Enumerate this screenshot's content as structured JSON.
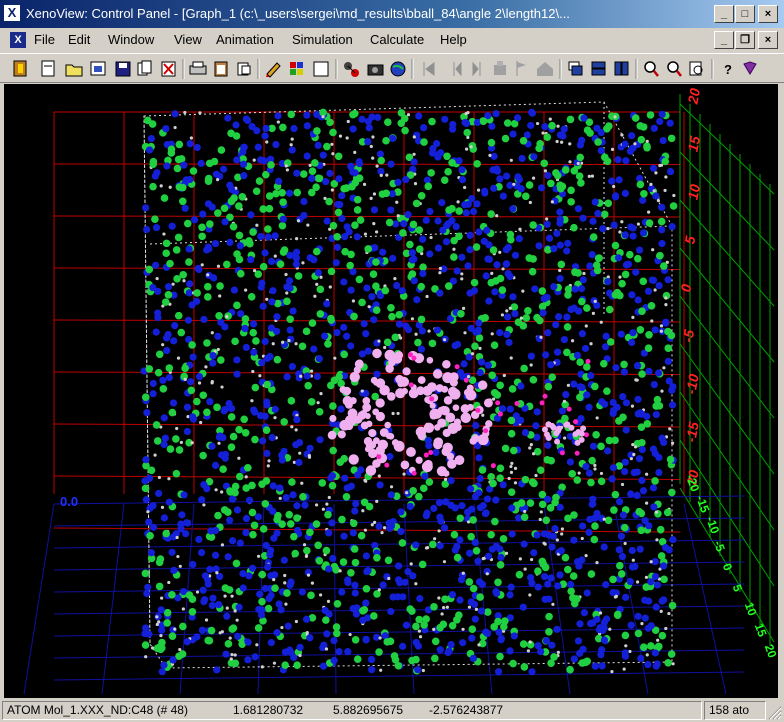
{
  "window": {
    "title": "XenoView: Control Panel - [Graph_1  (c:\\_users\\sergei\\md_results\\bball_84\\angle 2\\length12\\...",
    "app_icon": "X",
    "minimize": "_",
    "maximize": "□",
    "close": "×",
    "mdi_minimize": "_",
    "mdi_restore": "❐",
    "mdi_close": "×"
  },
  "menu": {
    "icon": "X",
    "items": [
      "File",
      "Edit",
      "Window",
      "View",
      "Animation",
      "Simulation",
      "Calculate",
      "Help"
    ]
  },
  "toolbar": {
    "icons": [
      "exit-icon",
      "new-icon",
      "open-icon",
      "import-icon",
      "save-icon",
      "copy-icon",
      "delete-icon",
      "print-icon",
      "clipboard-icon",
      "cut-icon",
      "pencil-icon",
      "color-grid-icon",
      "box-icon",
      "molecule-icon",
      "camera-icon",
      "globe-icon",
      "step-first-icon",
      "step-back-icon",
      "step-forward-icon",
      "build-icon",
      "flag-icon",
      "home-icon",
      "tile-icon",
      "cascade-icon",
      "columns-icon",
      "zoom-in-icon",
      "zoom-out-icon",
      "zoom-page-icon",
      "help-icon",
      "gem-icon"
    ]
  },
  "viewport": {
    "axis_label_left": "0.0",
    "z_ticks": [
      "20",
      "15",
      "10",
      "5",
      "0",
      "-5",
      "-10",
      "-15",
      "-20"
    ],
    "x_ticks_right": [
      "-20",
      "-15",
      "-10",
      "-5",
      "0",
      "5",
      "10",
      "15",
      "20"
    ],
    "colors": {
      "nitrogen": "#1420d8",
      "carbon": "#20d040",
      "hydrogen": "#d0d0d0",
      "solute": "#f0b0f0",
      "solute_accent": "#ff20c0",
      "grid_red": "#c00000",
      "grid_blue": "#1010a0",
      "grid_green": "#00a000",
      "tick_red": "#ff2020",
      "tick_green": "#20ff20"
    }
  },
  "status": {
    "atom": "ATOM Mol_1.XXX_ND:C48 (# 48)",
    "x": "1.681280732",
    "y": "5.882695675",
    "z": "-2.576243877",
    "count": "158 ato"
  }
}
